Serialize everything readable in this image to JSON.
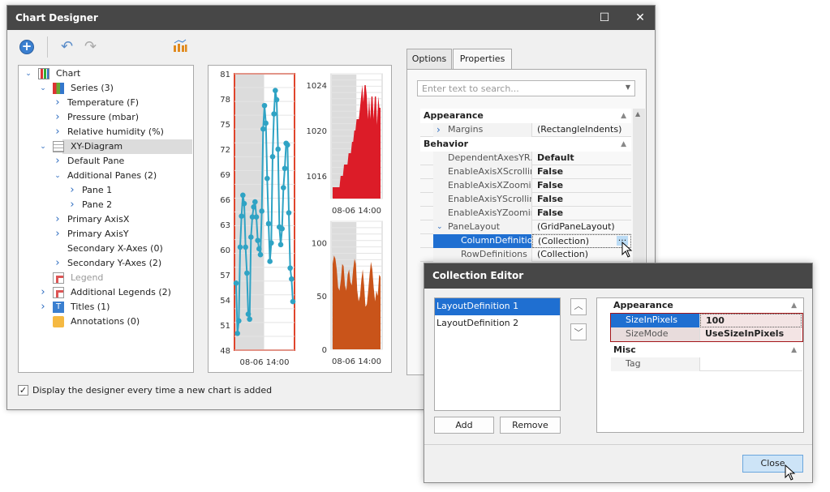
{
  "window": {
    "title": "Chart Designer",
    "maximize_icon": "maximize-icon",
    "close_icon": "close-icon"
  },
  "toolbar": {
    "add_icon": "plus-circle-icon",
    "undo_icon": "undo-icon",
    "redo_icon": "redo-icon",
    "chart_wizard_icon": "chart-icon"
  },
  "tree": {
    "items": [
      {
        "label": "Chart",
        "expanded": true
      },
      {
        "label": "Series (3)",
        "expanded": true
      },
      {
        "label": "Temperature (F)"
      },
      {
        "label": "Pressure (mbar)"
      },
      {
        "label": "Relative humidity (%)"
      },
      {
        "label": "XY-Diagram",
        "expanded": true,
        "selected": true
      },
      {
        "label": "Default Pane"
      },
      {
        "label": "Additional Panes (2)",
        "expanded": true
      },
      {
        "label": "Pane 1"
      },
      {
        "label": "Pane 2"
      },
      {
        "label": "Primary AxisX"
      },
      {
        "label": "Primary AxisY"
      },
      {
        "label": "Secondary X-Axes (0)"
      },
      {
        "label": "Secondary Y-Axes (2)"
      },
      {
        "label": "Legend",
        "disabled": true
      },
      {
        "label": "Additional Legends (2)"
      },
      {
        "label": "Titles (1)"
      },
      {
        "label": "Annotations (0)"
      }
    ]
  },
  "preview": {
    "x_label": "08-06 14:00",
    "temperature": {
      "ticks": [
        "81",
        "78",
        "75",
        "72",
        "69",
        "66",
        "63",
        "60",
        "57",
        "54",
        "51",
        "48"
      ],
      "range": [
        48,
        81
      ],
      "values": [
        56,
        50,
        51.5,
        60.3,
        64,
        66.5,
        65.5,
        60.3,
        57.2,
        52.3,
        51.7,
        61.5,
        63.9,
        65.1,
        65.7,
        63.9,
        61.1,
        60.1,
        59.4,
        64.6,
        74.4,
        77.2,
        75.1,
        68.5,
        63.1,
        58.6,
        60.8,
        71.1,
        76.2,
        79,
        77.9,
        72,
        62.7,
        60.6,
        62.5,
        67.4,
        69.7,
        72.7,
        72.5,
        64.4,
        57.8,
        56.5,
        53.8
      ],
      "color": "#2fa3c4"
    },
    "pressure": {
      "ticks": [
        "1024",
        "1020",
        "1016"
      ],
      "range": [
        1014,
        1025
      ],
      "values": [
        1015,
        1015,
        1015,
        1015,
        1015,
        1015,
        1015,
        1016,
        1016,
        1016,
        1017,
        1017,
        1017,
        1017,
        1018,
        1018,
        1018,
        1019,
        1019,
        1020,
        1020,
        1021,
        1021,
        1021,
        1022,
        1023,
        1024,
        1022.5,
        1024,
        1024,
        1023,
        1021,
        1023,
        1021,
        1023,
        1023,
        1021,
        1023,
        1023,
        1020.5,
        1023,
        1022,
        1022
      ],
      "color": "#dc1c28"
    },
    "humidity": {
      "ticks": [
        "100",
        "50",
        "0"
      ],
      "range": [
        0,
        120
      ],
      "values": [
        80,
        88,
        85,
        75,
        58,
        55,
        65,
        80,
        78,
        60,
        55,
        70,
        75,
        63,
        60,
        75,
        85,
        80,
        55,
        45,
        50,
        65,
        75,
        60,
        40,
        42,
        55,
        70,
        82,
        75,
        58,
        45,
        55,
        50,
        70,
        68
      ],
      "color": "#c9541a"
    }
  },
  "tabs": [
    {
      "label": "Options"
    },
    {
      "label": "Properties",
      "active": true
    }
  ],
  "search": {
    "placeholder": "Enter text to search..."
  },
  "properties": {
    "categories": [
      {
        "label": "Appearance"
      },
      {
        "label": "Behavior"
      }
    ],
    "rows": [
      {
        "name": "Margins",
        "value": "(RectangleIndents)",
        "expandable": true
      },
      {
        "name": "DependentAxesYR...",
        "value": "Default",
        "bold": true
      },
      {
        "name": "EnableAxisXScrolling",
        "value": "False",
        "bold": true
      },
      {
        "name": "EnableAxisXZooming",
        "value": "False",
        "bold": true
      },
      {
        "name": "EnableAxisYScrolling",
        "value": "False",
        "bold": true
      },
      {
        "name": "EnableAxisYZooming",
        "value": "False",
        "bold": true
      },
      {
        "name": "PaneLayout",
        "value": "(GridPaneLayout)",
        "expanded": true
      },
      {
        "name": "ColumnDefinitions",
        "value": "(Collection)",
        "selected": true
      },
      {
        "name": "RowDefinitions",
        "value": "(Collection)"
      }
    ],
    "ellipsis_label": "..."
  },
  "footer": {
    "checkbox_label": "Display the designer every time a new chart is added",
    "checked": true
  },
  "collection_editor": {
    "title": "Collection Editor",
    "items": [
      {
        "label": "LayoutDefinition 1",
        "selected": true
      },
      {
        "label": "LayoutDefinition 2"
      }
    ],
    "add_label": "Add",
    "remove_label": "Remove",
    "categories": [
      {
        "label": "Appearance"
      },
      {
        "label": "Misc"
      }
    ],
    "rows": [
      {
        "name": "SizeInPixels",
        "value": "100"
      },
      {
        "name": "SizeMode",
        "value": "UseSizeInPixels"
      },
      {
        "name": "Tag",
        "value": ""
      }
    ],
    "close_label": "Close"
  }
}
